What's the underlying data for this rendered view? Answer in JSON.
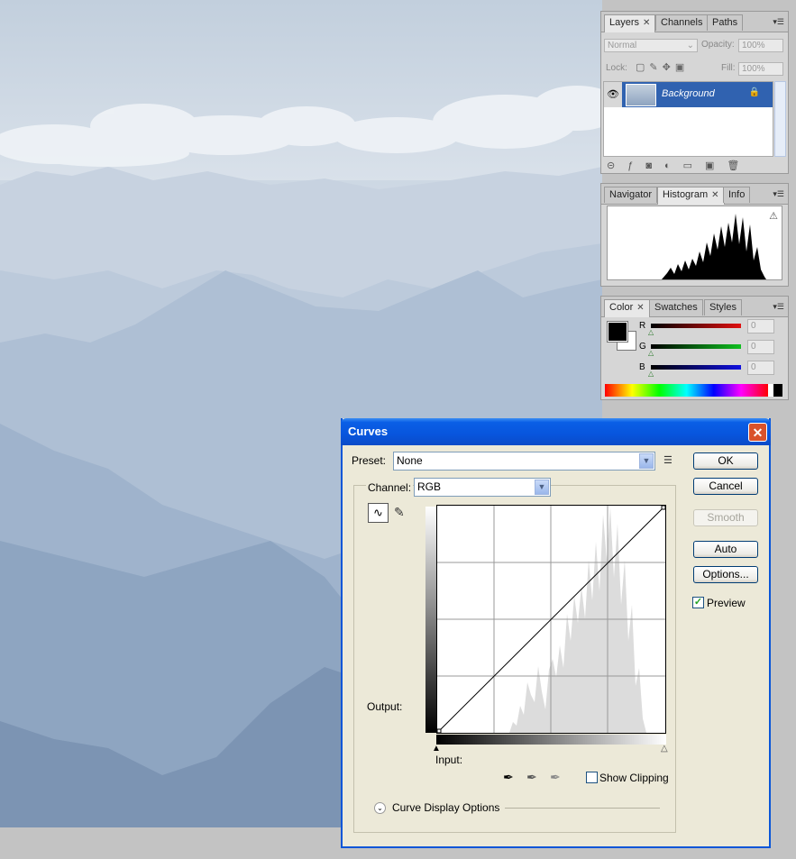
{
  "layers_panel": {
    "tabs": [
      "Layers",
      "Channels",
      "Paths"
    ],
    "blend_mode": "Normal",
    "opacity_label": "Opacity:",
    "opacity_value": "100%",
    "lock_label": "Lock:",
    "fill_label": "Fill:",
    "fill_value": "100%",
    "layer_name": "Background"
  },
  "histogram_panel": {
    "tabs": [
      "Navigator",
      "Histogram",
      "Info"
    ]
  },
  "color_panel": {
    "tabs": [
      "Color",
      "Swatches",
      "Styles"
    ],
    "channels": [
      {
        "label": "R",
        "value": "0",
        "color": "#e01010"
      },
      {
        "label": "G",
        "value": "0",
        "color": "#10c020"
      },
      {
        "label": "B",
        "value": "0",
        "color": "#1010e0"
      }
    ]
  },
  "curves_dialog": {
    "title": "Curves",
    "preset_label": "Preset:",
    "preset_value": "None",
    "channel_label": "Channel:",
    "channel_value": "RGB",
    "output_label": "Output:",
    "input_label": "Input:",
    "show_clipping_label": "Show Clipping",
    "curve_display_options_label": "Curve Display Options",
    "buttons": {
      "ok": "OK",
      "cancel": "Cancel",
      "smooth": "Smooth",
      "auto": "Auto",
      "options": "Options..."
    },
    "preview_label": "Preview",
    "preview_checked": true
  }
}
